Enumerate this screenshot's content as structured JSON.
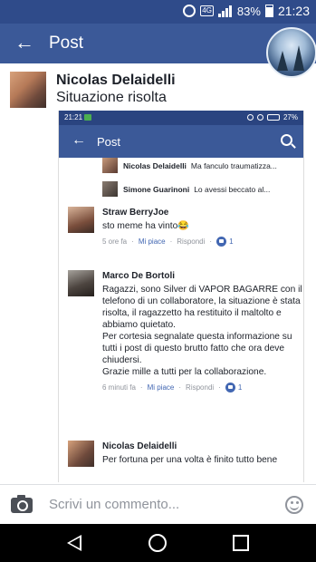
{
  "status_bar": {
    "battery": "83%",
    "time": "21:23",
    "network": "4G"
  },
  "header": {
    "title": "Post"
  },
  "post": {
    "author": "Nicolas Delaidelli",
    "text": "Situazione risolta"
  },
  "screenshot": {
    "status": {
      "time": "21:21",
      "battery": "27%"
    },
    "title": "Post",
    "replies": [
      {
        "name": "Nicolas Delaidelli",
        "text": "Ma fancul​o traumatizza..."
      },
      {
        "name": "Simone Guarinoni",
        "text": "Lo avessi beccato al..."
      }
    ],
    "comments": [
      {
        "name": "Straw BerryJoe",
        "text": "sto meme ha vinto😂",
        "time": "5 ore fa",
        "like": "Mi piace",
        "reply": "Rispondi",
        "likes": "1"
      },
      {
        "name": "Marco De Bortoli",
        "text": "Ragazzi, sono Silver di VAPOR BAGARRE con il telefono di un collaboratore, la situazione è stata risolta, il ragazzetto ha restituito il maltolto e abbiamo quietato.\nPer cortesia segnalate questa informazione su tutti i post di questo brutto fatto che ora deve chiudersi.\nGrazie mille a tutti per la collaborazione.",
        "time": "6 minuti fa",
        "like": "Mi piace",
        "reply": "Rispondi",
        "likes": "1"
      },
      {
        "name": "Nicolas Delaidelli",
        "text": "Per fortuna per una volta è finito tutto bene"
      }
    ]
  },
  "composer": {
    "placeholder": "Scrivi un commento..."
  },
  "colors": {
    "brand": "#3b5998",
    "status_bar": "#2f4b8a",
    "link": "#4267b2"
  }
}
